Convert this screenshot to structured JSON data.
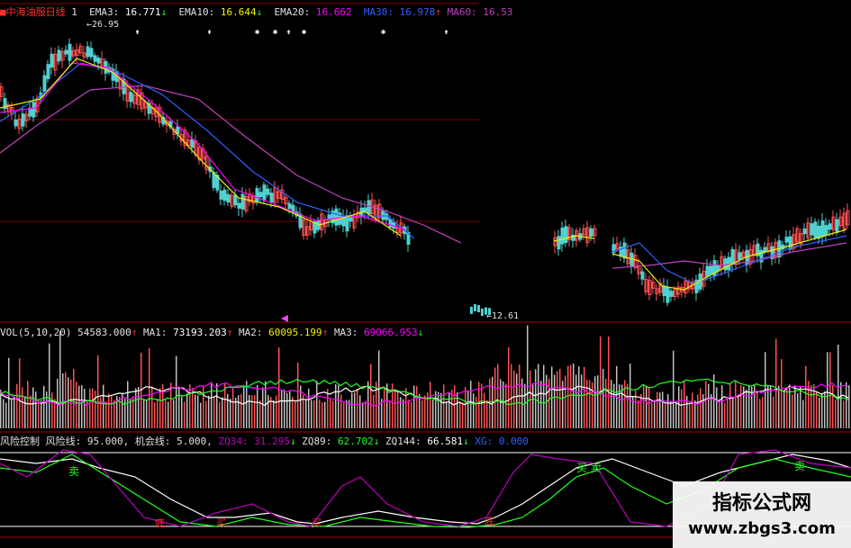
{
  "colors": {
    "background": "#000000",
    "grid": "#8a0000",
    "label_white": "#e0e0e0",
    "ema3": "#ffffff",
    "ema10": "#f0f000",
    "ema20": "#ff00ff",
    "ma30": "#3060ff",
    "ma60": "#c040c0",
    "candle_up": "#ff5050",
    "candle_down": "#50d0d0",
    "vol_ma1": "#ffffff",
    "vol_ma2": "#f0f000",
    "vol_ma3": "#ff00ff",
    "risk_line": "#ffffff",
    "zq89": "#20ff20",
    "zq144": "#ffffff",
    "zq34": "#c000c0"
  },
  "price_panel": {
    "stock_name": "中海油服",
    "period": "日线",
    "adj": "1",
    "ema3_label": "EMA3:",
    "ema3_value": "16.771",
    "ema3_arrow": "↓",
    "ema10_label": "EMA10:",
    "ema10_value": "16.644",
    "ema10_arrow": "↓",
    "ema20_label": "EMA20:",
    "ema20_value": "16.662",
    "ma30_label": "MA30:",
    "ma30_value": "16.978",
    "ma30_arrow": "↑",
    "ma60_label": "MA60:",
    "ma60_value": "16.53",
    "high_marker": "26.95",
    "low_marker": "12.61"
  },
  "volume_panel": {
    "label": "VOL(5,10,20)",
    "vol_value": "54583.000",
    "vol_arrow": "↑",
    "ma1_label": "MA1:",
    "ma1_value": "73193.203",
    "ma1_arrow": "↑",
    "ma2_label": "MA2:",
    "ma2_value": "60095.199",
    "ma2_arrow": "↑",
    "ma3_label": "MA3:",
    "ma3_value": "69066.953",
    "ma3_arrow": "↓"
  },
  "indicator_panel": {
    "label": "风险控制",
    "risk_label": "风险线:",
    "risk_value": "95.000,",
    "chance_label": "机会线:",
    "chance_value": "5.000,",
    "zq34_label": "ZQ34:",
    "zq34_value": "31.295",
    "zq34_arrow": "↓",
    "zq89_label": "ZQ89:",
    "zq89_value": "62.702",
    "zq89_arrow": "↓",
    "zq144_label": "ZQ144:",
    "zq144_value": "66.581",
    "zq144_arrow": "↓",
    "xg_label": "XG:",
    "xg_value": "0.000",
    "sell_mark": "卖",
    "buy_mark": "买",
    "bottom_mark": "底"
  },
  "watermark": {
    "title": "指标公式网",
    "url": "www.zbgs3.com"
  }
}
